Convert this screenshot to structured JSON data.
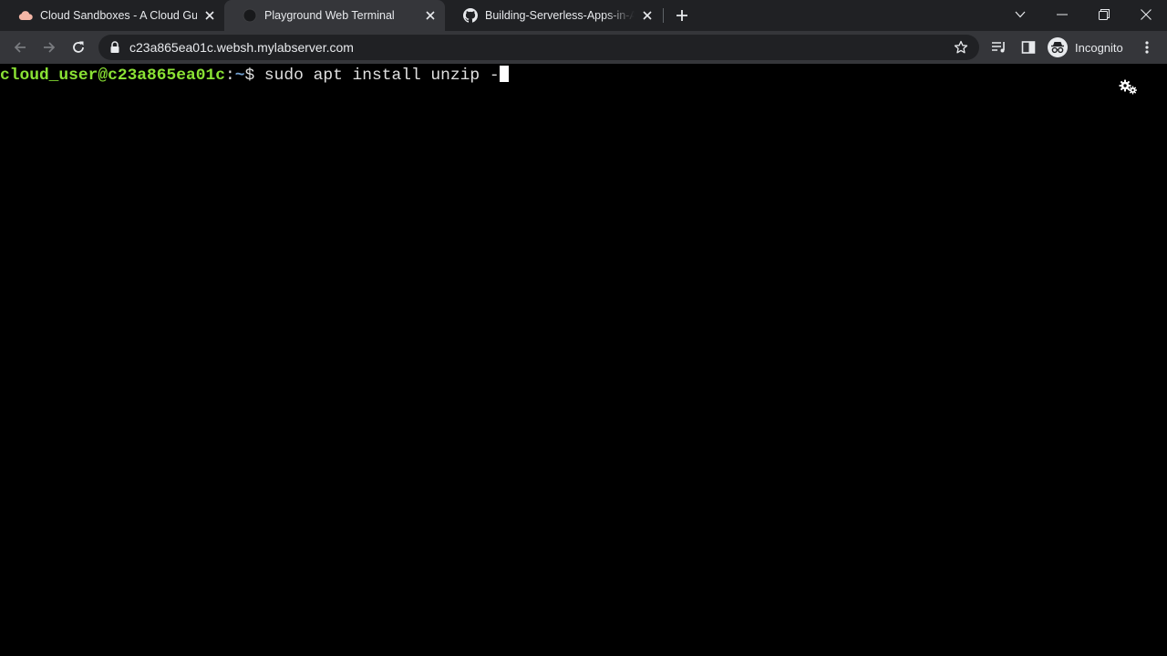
{
  "tabs": [
    {
      "title": "Cloud Sandboxes - A Cloud Guru",
      "icon": "cloud-icon"
    },
    {
      "title": "Playground Web Terminal",
      "icon": "terminal-favicon-icon",
      "active": true
    },
    {
      "title": "Building-Serverless-Apps-in-AWS",
      "icon": "github-icon"
    }
  ],
  "toolbar": {
    "url": "c23a865ea01c.websh.mylabserver.com",
    "profile_label": "Incognito"
  },
  "terminal": {
    "prompt_user": "cloud_user@c23a865ea01c",
    "prompt_sep": ":",
    "prompt_path": "~",
    "prompt_symbol": "$ ",
    "command": "sudo apt install unzip -"
  },
  "colors": {
    "tabstrip_bg": "#202124",
    "toolbar_bg": "#35363a",
    "prompt_green": "#8ae234",
    "prompt_blue": "#729fcf",
    "cloud_icon": "#f4b6a6"
  }
}
